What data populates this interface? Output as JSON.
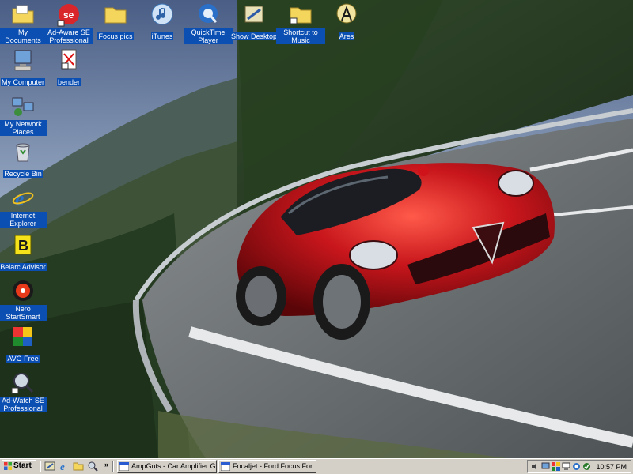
{
  "desktop": {
    "icons": [
      {
        "label": "My Documents",
        "icon": "folder-documents-icon"
      },
      {
        "label": "Ad-Aware SE Professional",
        "icon": "ad-aware-icon"
      },
      {
        "label": "Focus pics",
        "icon": "folder-icon"
      },
      {
        "label": "iTunes",
        "icon": "itunes-icon"
      },
      {
        "label": "QuickTime Player",
        "icon": "quicktime-icon"
      },
      {
        "label": "Show Desktop",
        "icon": "show-desktop-icon"
      },
      {
        "label": "Shortcut to Music",
        "icon": "folder-shortcut-icon"
      },
      {
        "label": "Ares",
        "icon": "ares-icon"
      },
      {
        "label": "My Computer",
        "icon": "my-computer-icon"
      },
      {
        "label": "bender",
        "icon": "bender-file-icon"
      },
      {
        "label": "My Network Places",
        "icon": "network-places-icon"
      },
      {
        "label": "Recycle Bin",
        "icon": "recycle-bin-icon"
      },
      {
        "label": "Internet Explorer",
        "icon": "internet-explorer-icon"
      },
      {
        "label": "Belarc Advisor",
        "icon": "belarc-icon"
      },
      {
        "label": "Nero StartSmart",
        "icon": "nero-icon"
      },
      {
        "label": "AVG Free",
        "icon": "avg-icon"
      },
      {
        "label": "Ad-Watch SE Professional",
        "icon": "ad-watch-icon"
      }
    ]
  },
  "taskbar": {
    "start_label": "Start",
    "quick_launch_overflow": "»",
    "tasks": [
      {
        "label": "AmpGuts - Car Amplifier G...",
        "icon": "ie-window-icon"
      },
      {
        "label": "Focaljet - Ford Focus For...",
        "icon": "ie-window-icon"
      }
    ],
    "clock": "10:57 PM"
  },
  "colors": {
    "taskbar": "#d4d0c8",
    "icon_label_bg": "#0b4fb3",
    "car_red": "#c0141a"
  }
}
